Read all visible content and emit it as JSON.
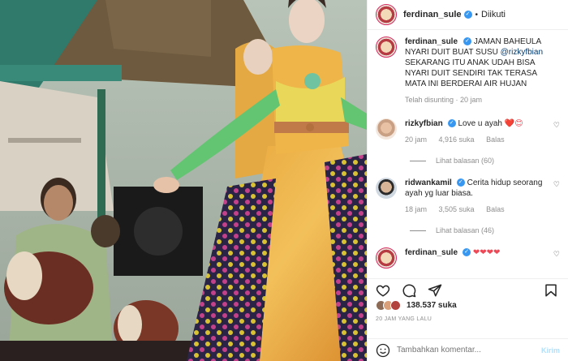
{
  "post": {
    "username": "ferdinan_sule",
    "follow_status": "Diikuti",
    "caption_user": "ferdinan_sule",
    "caption_text": "JAMAN BAHEULA NYARI DUIT BUAT SUSU",
    "caption_mention": "@rizkyfbian",
    "caption_text2": "SEKARANG ITU ANAK UDAH BISA NYARI DUIT SENDIRI TAK TERASA MATA INI BERDERAI AIR HUJAN",
    "caption_meta": "Telah disunting · 20 jam"
  },
  "comments": [
    {
      "username": "rizkyfbian",
      "text": "Love u ayah",
      "emoji": "❤️😊",
      "time": "20 jam",
      "likes": "4,916 suka",
      "reply": "Balas",
      "replies": "Lihat balasan (60)"
    },
    {
      "username": "ridwankamil",
      "text": "Cerita hidup seorang ayah yg luar biasa.",
      "emoji": "",
      "time": "18 jam",
      "likes": "3,505 suka",
      "reply": "Balas",
      "replies": "Lihat balasan (46)"
    },
    {
      "username": "ferdinan_sule",
      "text": "",
      "emoji": "❤❤❤❤",
      "time": "",
      "likes": "",
      "reply": "",
      "replies": ""
    }
  ],
  "stats": {
    "likes": "138.537 suka",
    "date": "20 JAM YANG LALU"
  },
  "composer": {
    "placeholder": "Tambahkan komentar...",
    "post_label": "Kirim"
  },
  "colors": {
    "verified": "#3897f0",
    "link": "#00376b",
    "heart": "#ed4956",
    "post_button": "#b2dffc"
  }
}
